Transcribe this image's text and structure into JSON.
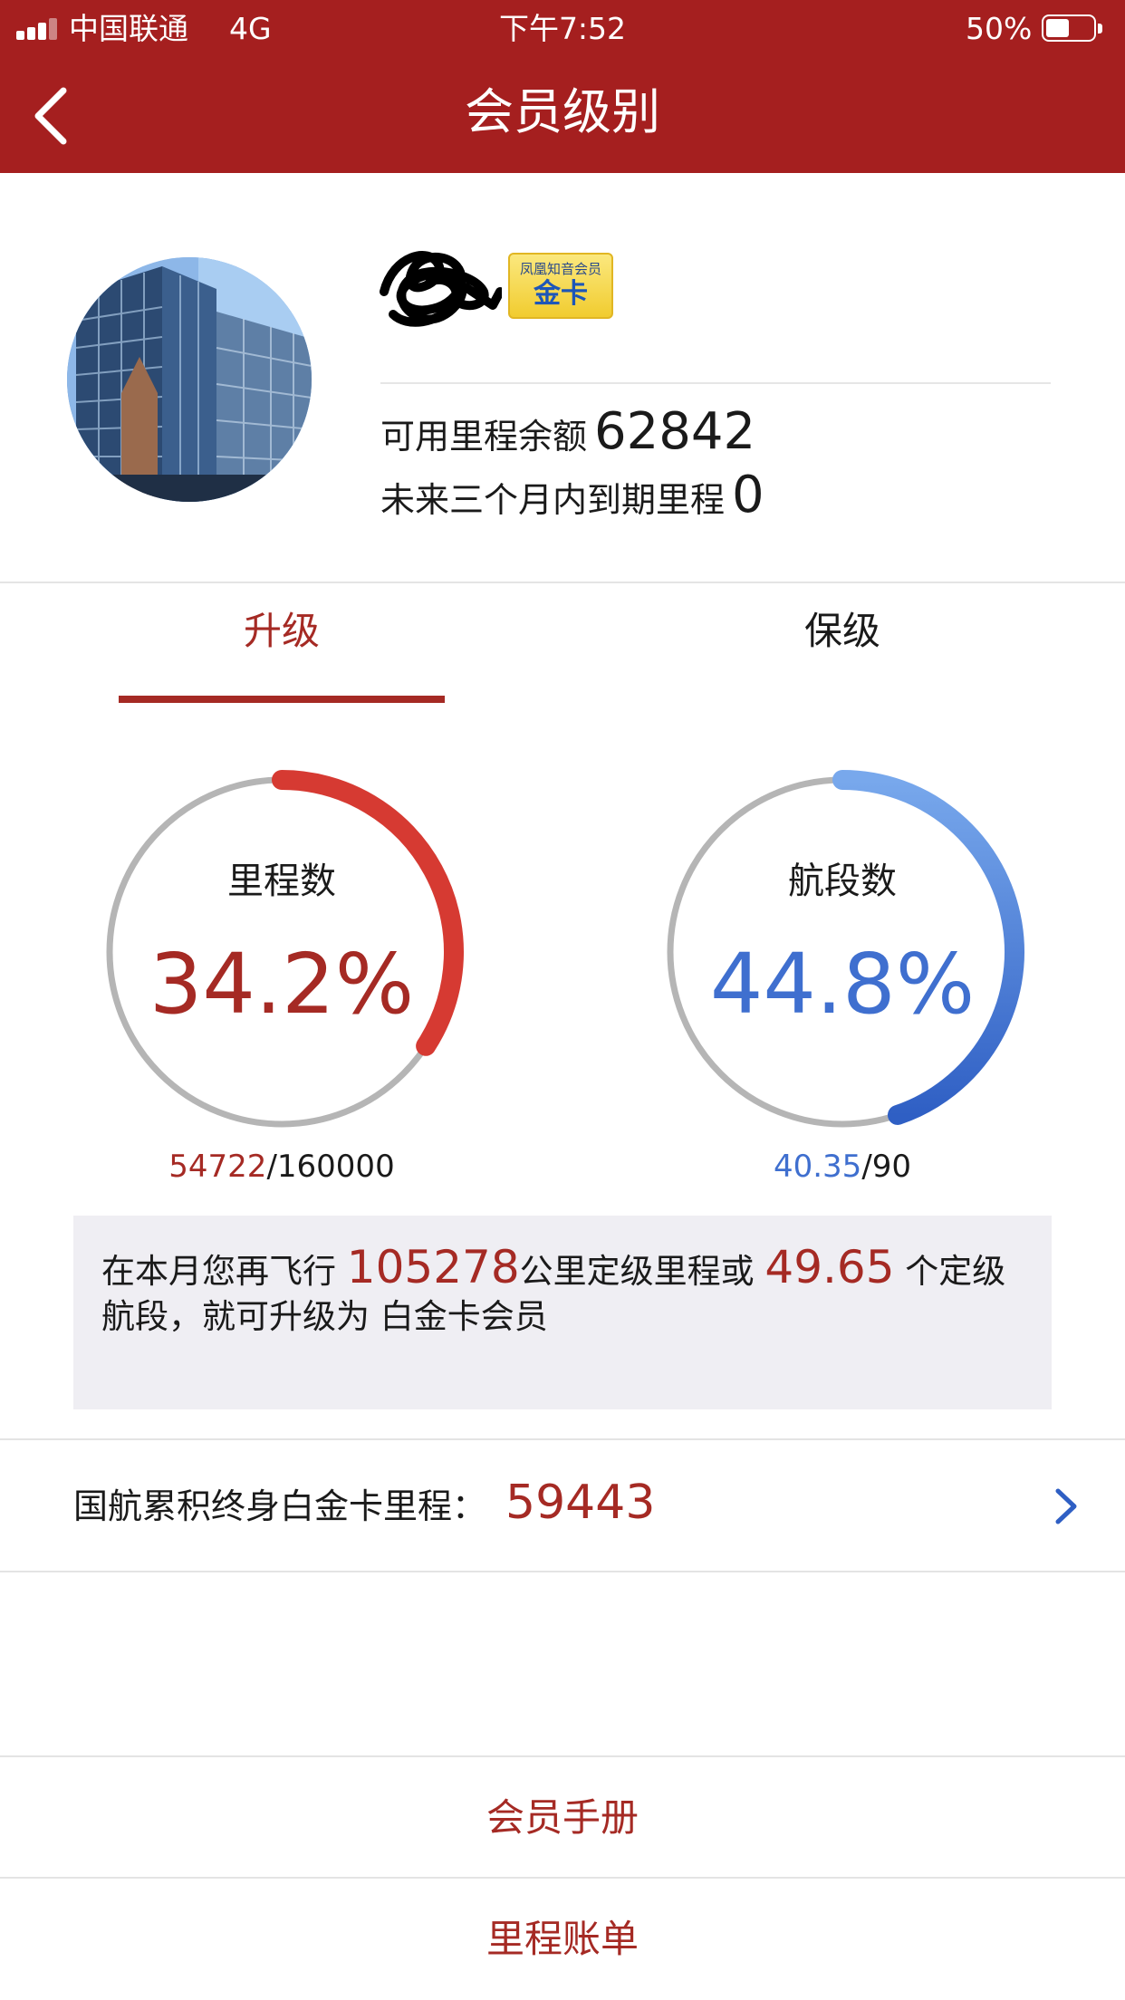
{
  "status_bar": {
    "carrier": "中国联通",
    "network": "4G",
    "time": "下午7:52",
    "battery": "50%"
  },
  "nav": {
    "title": "会员级别"
  },
  "profile": {
    "badge_small": "凤凰知音会员",
    "badge_tier": "金卡",
    "available_miles_label": "可用里程余额",
    "available_miles": "62842",
    "expiring_label": "未来三个月内到期里程",
    "expiring_miles": "0"
  },
  "tabs": [
    {
      "label": "升级",
      "active": true
    },
    {
      "label": "保级",
      "active": false
    }
  ],
  "progress": {
    "miles": {
      "label": "里程数",
      "percent_text": "34.2%",
      "percent": 34.2,
      "current": "54722",
      "target": "/160000",
      "color": "#d63a32",
      "text_color": "#a52a24"
    },
    "segments": {
      "label": "航段数",
      "percent_text": "44.8%",
      "percent": 44.8,
      "current": "40.35",
      "target": "/90",
      "color_start": "#78a8ec",
      "color_end": "#2f5fc4",
      "text_color": "#3f6fcf"
    },
    "track_color": "#b5b5b5"
  },
  "upgrade_info": {
    "part1": "在本月您再飞行 ",
    "miles_needed": "105278",
    "part2": "公里定级里程或 ",
    "segments_needed": "49.65",
    "part3": " 个定级航段，就可升级为 白金卡会员"
  },
  "lifetime": {
    "label": "国航累积终身白金卡里程：",
    "value": "59443"
  },
  "links": {
    "handbook": "会员手册",
    "statement": "里程账单"
  },
  "colors": {
    "brand_red": "#a51f1f",
    "accent_red": "#a52a24",
    "accent_blue": "#3f6fcf",
    "info_bg": "#efeef3"
  }
}
